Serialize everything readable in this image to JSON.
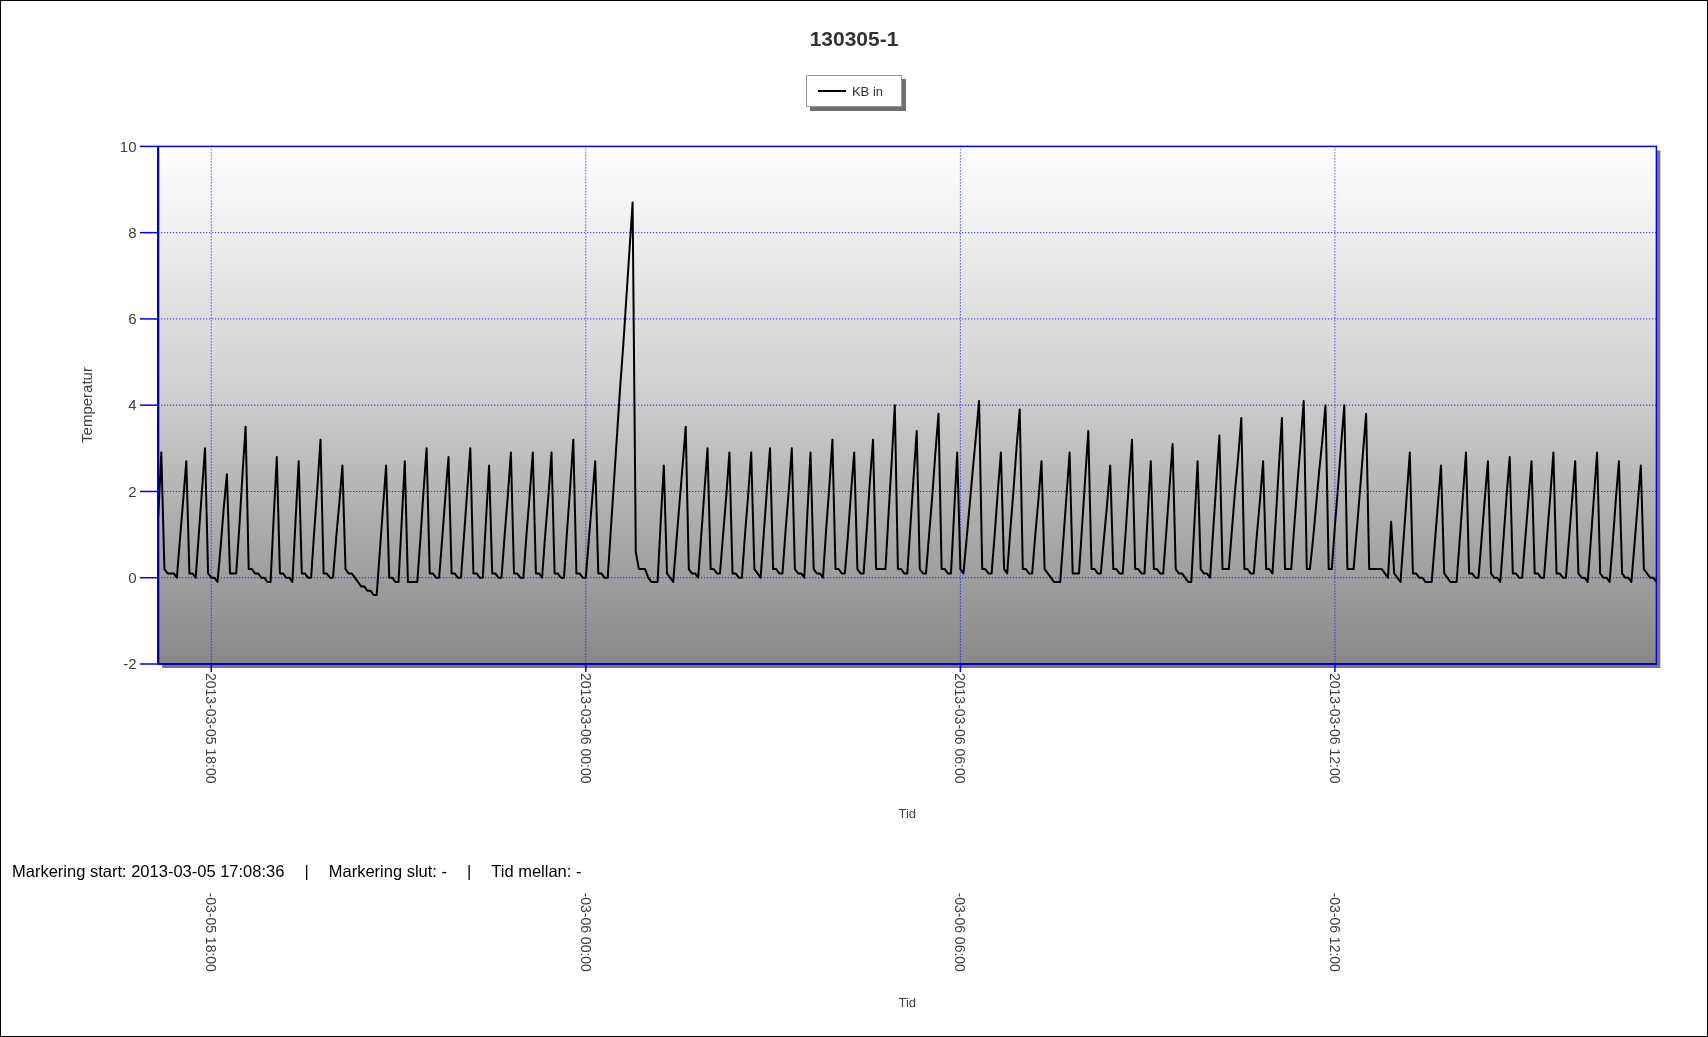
{
  "chart": {
    "chart_data": {
      "type": "line",
      "title": "130305-1",
      "xlabel": "Tid",
      "ylabel": "Temperatur",
      "grid": true,
      "categories": [
        null,
        null,
        null,
        null,
        null,
        null,
        null,
        null,
        null,
        null,
        null,
        null,
        null,
        null,
        null,
        null,
        null,
        "2013-03-05 18:00",
        null,
        null,
        null,
        null,
        null,
        null,
        null,
        null,
        null,
        null,
        null,
        null,
        null,
        null,
        null,
        null,
        null,
        null,
        null,
        null,
        null,
        null,
        null,
        null,
        null,
        null,
        null,
        null,
        null,
        null,
        null,
        null,
        null,
        null,
        null,
        null,
        null,
        null,
        null,
        null,
        null,
        null,
        null,
        null,
        null,
        null,
        null,
        null,
        null,
        null,
        null,
        null,
        null,
        null,
        null,
        null,
        null,
        null,
        null,
        null,
        null,
        null,
        null,
        null,
        null,
        null,
        null,
        null,
        null,
        null,
        null,
        null,
        null,
        null,
        null,
        null,
        null,
        null,
        null,
        null,
        null,
        null,
        null,
        null,
        null,
        null,
        null,
        null,
        null,
        null,
        null,
        null,
        null,
        null,
        null,
        null,
        null,
        null,
        null,
        null,
        null,
        null,
        null,
        null,
        null,
        null,
        null,
        null,
        null,
        null,
        null,
        null,
        null,
        null,
        null,
        null,
        null,
        null,
        null,
        "2013-03-06 00:00",
        null,
        null,
        null,
        null,
        null,
        null,
        null,
        null,
        null,
        null,
        null,
        null,
        null,
        null,
        null,
        null,
        null,
        null,
        null,
        null,
        null,
        null,
        null,
        null,
        null,
        null,
        null,
        null,
        null,
        null,
        null,
        null,
        null,
        null,
        null,
        null,
        null,
        null,
        null,
        null,
        null,
        null,
        null,
        null,
        null,
        null,
        null,
        null,
        null,
        null,
        null,
        null,
        null,
        null,
        null,
        null,
        null,
        null,
        null,
        null,
        null,
        null,
        null,
        null,
        null,
        null,
        null,
        null,
        null,
        null,
        null,
        null,
        null,
        null,
        null,
        null,
        null,
        null,
        null,
        null,
        null,
        null,
        null,
        null,
        null,
        null,
        null,
        null,
        null,
        null,
        null,
        null,
        null,
        null,
        null,
        null,
        null,
        null,
        null,
        null,
        null,
        null,
        null,
        null,
        null,
        null,
        null,
        null,
        null,
        null,
        null,
        null,
        null,
        null,
        null,
        null,
        null,
        null,
        null,
        "2013-03-06 06:00",
        null,
        null,
        null,
        null,
        null,
        null,
        null,
        null,
        null,
        null,
        null,
        null,
        null,
        null,
        null,
        null,
        null,
        null,
        null,
        null,
        null,
        null,
        null,
        null,
        null,
        null,
        null,
        null,
        null,
        null,
        null,
        null,
        null,
        null,
        null,
        null,
        null,
        null,
        null,
        null,
        null,
        null,
        null,
        null,
        null,
        null,
        null,
        null,
        null,
        null,
        null,
        null,
        null,
        null,
        null,
        null,
        null,
        null,
        null,
        null,
        null,
        null,
        null,
        null,
        null,
        null,
        null,
        null,
        null,
        null,
        null,
        null,
        null,
        null,
        null,
        null,
        null,
        null,
        null,
        null,
        null,
        null,
        null,
        null,
        null,
        null,
        null,
        null,
        null,
        null,
        null,
        null,
        null,
        null,
        null,
        null,
        null,
        null,
        null,
        null,
        null,
        null,
        null,
        null,
        null,
        null,
        null,
        null,
        null,
        null,
        null,
        null,
        null,
        null,
        null,
        null,
        null,
        null,
        null,
        "2013-03-06 12:00",
        null,
        null,
        null,
        null,
        null,
        null,
        null,
        null,
        null,
        null,
        null,
        null,
        null,
        null,
        null,
        null,
        null,
        null,
        null,
        null,
        null,
        null,
        null,
        null,
        null,
        null,
        null,
        null,
        null,
        null,
        null,
        null,
        null,
        null,
        null,
        null,
        null,
        null,
        null,
        null,
        null,
        null,
        null,
        null,
        null,
        null,
        null,
        null,
        null,
        null,
        null,
        null,
        null,
        null,
        null,
        null,
        null,
        null,
        null,
        null,
        null,
        null,
        null,
        null,
        null,
        null,
        null,
        null,
        null,
        null,
        null,
        null,
        null,
        null,
        null,
        null,
        null,
        null,
        null,
        null,
        null,
        null,
        null,
        null,
        null,
        null,
        null,
        null,
        null,
        null,
        null,
        null,
        null,
        null,
        null,
        null,
        null,
        null,
        null,
        null,
        null,
        null,
        null
      ],
      "series": [
        {
          "name": "KB in",
          "color": "#000000",
          "values": [
            1.4,
            2.9,
            0.2,
            0.1,
            0.1,
            0.1,
            0,
            0.9,
            1.8,
            2.7,
            0.1,
            0.1,
            0,
            1.0,
            2.0,
            3.0,
            0.1,
            0,
            0,
            -0.1,
            0.7,
            1.6,
            2.4,
            0.1,
            0.1,
            0.1,
            1.2,
            2.4,
            3.5,
            0.2,
            0.2,
            0.1,
            0.1,
            0,
            0,
            -0.1,
            -0.1,
            1.4,
            2.8,
            0.1,
            0.1,
            0,
            0,
            -0.1,
            1.3,
            2.7,
            0.1,
            0.1,
            0,
            0,
            1.1,
            2.1,
            3.2,
            0.1,
            0.1,
            0,
            0,
            0.9,
            1.7,
            2.6,
            0.2,
            0.1,
            0.1,
            0,
            -0.1,
            -0.2,
            -0.2,
            -0.3,
            -0.3,
            -0.4,
            -0.4,
            0.6,
            1.6,
            2.6,
            0,
            0,
            -0.1,
            -0.1,
            1.3,
            2.7,
            -0.1,
            -0.1,
            -0.1,
            -0.1,
            0.9,
            2.0,
            3.0,
            0.1,
            0.1,
            0,
            0,
            0.9,
            1.9,
            2.8,
            0.1,
            0.1,
            0,
            0,
            1.0,
            2.0,
            3.0,
            0.1,
            0.1,
            0,
            0,
            1.3,
            2.6,
            0.1,
            0.1,
            0,
            0,
            1.0,
            1.9,
            2.9,
            0.1,
            0.1,
            0,
            0,
            1.0,
            1.9,
            2.9,
            0.1,
            0.1,
            0,
            1.0,
            1.9,
            2.9,
            0.1,
            0.1,
            0,
            0,
            1.1,
            2.1,
            3.2,
            0.1,
            0.1,
            0,
            0,
            0.9,
            1.8,
            2.7,
            0.1,
            0.1,
            0,
            0,
            1.1,
            2.2,
            3.3,
            4.4,
            5.4,
            6.5,
            7.6,
            8.7,
            0.6,
            0.2,
            0.2,
            0.2,
            0,
            -0.1,
            -0.1,
            -0.1,
            1.3,
            2.6,
            0.1,
            0,
            -0.1,
            0.8,
            1.7,
            2.6,
            3.5,
            0.2,
            0.1,
            0.1,
            0,
            1.0,
            2.0,
            3.0,
            0.2,
            0.2,
            0.1,
            0.1,
            1.0,
            1.9,
            2.9,
            0.1,
            0.1,
            0,
            0,
            1.0,
            1.9,
            2.9,
            0.2,
            0.1,
            0,
            1.0,
            2.0,
            3.0,
            0.2,
            0.2,
            0.1,
            0.1,
            1.1,
            2.0,
            3.0,
            0.2,
            0.1,
            0.1,
            0,
            1.5,
            2.9,
            0.2,
            0.1,
            0.1,
            0,
            1.1,
            2.1,
            3.2,
            0.2,
            0.2,
            0.1,
            0.1,
            1.0,
            2.0,
            2.9,
            0.2,
            0.1,
            0.1,
            1.1,
            2.2,
            3.2,
            0.2,
            0.2,
            0.2,
            0.2,
            1.5,
            2.7,
            4.0,
            0.2,
            0.2,
            0.1,
            0.1,
            1.2,
            2.3,
            3.4,
            0.2,
            0.1,
            0.1,
            1.0,
            1.9,
            2.9,
            3.8,
            0.2,
            0.2,
            0.1,
            0.1,
            1.5,
            2.9,
            0.2,
            0.1,
            0.9,
            1.7,
            2.5,
            3.3,
            4.1,
            0.2,
            0.2,
            0.1,
            0.1,
            1.0,
            2.0,
            2.9,
            0.2,
            0.1,
            1.1,
            2.0,
            3.0,
            3.9,
            0.2,
            0.2,
            0.1,
            0.1,
            1.0,
            1.8,
            2.7,
            0.2,
            0.1,
            0,
            -0.1,
            -0.1,
            -0.1,
            0.9,
            1.9,
            2.9,
            0.1,
            0.1,
            0.1,
            1.2,
            2.3,
            3.4,
            0.2,
            0.2,
            0.1,
            0.1,
            0.9,
            1.7,
            2.6,
            0.2,
            0.2,
            0.1,
            0.1,
            1.1,
            2.2,
            3.2,
            0.2,
            0.2,
            0.1,
            0.1,
            1.4,
            2.7,
            0.2,
            0.2,
            0.1,
            0.1,
            1.1,
            2.1,
            3.1,
            0.2,
            0.1,
            0.1,
            0,
            -0.1,
            -0.1,
            1.3,
            2.7,
            0.2,
            0.1,
            0.1,
            0,
            1.1,
            2.2,
            3.3,
            0.2,
            0.2,
            0.2,
            1.1,
            2.0,
            2.8,
            3.7,
            0.2,
            0.2,
            0.1,
            0.1,
            1.0,
            1.8,
            2.7,
            0.2,
            0.2,
            0.1,
            1.3,
            2.5,
            3.7,
            0.2,
            0.2,
            0.2,
            1.2,
            2.2,
            3.1,
            4.1,
            0.2,
            0.2,
            0.9,
            1.7,
            2.5,
            3.2,
            4.0,
            0.2,
            0.2,
            1.2,
            2.1,
            3.1,
            4.0,
            0.2,
            0.2,
            0.2,
            1.1,
            2.0,
            2.9,
            3.8,
            0.2,
            0.2,
            0.2,
            0.2,
            0.2,
            0.1,
            0,
            1.3,
            0.1,
            0,
            -0.1,
            0.9,
            1.9,
            2.9,
            0.1,
            0.1,
            0,
            0,
            -0.1,
            -0.1,
            -0.1,
            0.8,
            1.7,
            2.6,
            0.1,
            0,
            -0.1,
            -0.1,
            -0.1,
            0.9,
            1.9,
            2.9,
            0.1,
            0.1,
            0,
            0,
            0.9,
            1.8,
            2.7,
            0.1,
            0,
            0,
            -0.1,
            0.9,
            1.9,
            2.8,
            0.1,
            0.1,
            0,
            0,
            0.9,
            1.8,
            2.7,
            0.1,
            0.1,
            0,
            0,
            1.0,
            1.9,
            2.9,
            0.1,
            0.1,
            0,
            0,
            0.9,
            1.8,
            2.7,
            0.1,
            0,
            0,
            -0.1,
            0.9,
            1.9,
            2.9,
            0.1,
            0,
            0,
            -0.1,
            0.8,
            1.8,
            2.7,
            0.1,
            0,
            0,
            -0.1,
            0.8,
            1.7,
            2.6,
            0.2,
            0.1,
            0,
            0,
            -0.1
          ]
        }
      ],
      "ylim": [
        -2,
        10
      ],
      "yticks": [
        -2,
        0,
        2,
        4,
        6,
        8,
        10
      ]
    }
  },
  "status_bar": {
    "items": [
      "Markering start: 2013-03-05 17:08:36",
      "Markering slut: -",
      "Tid mellan: -"
    ],
    "separators": [
      "|",
      "|"
    ]
  },
  "axis_repeat": {
    "tick_labels": [
      "-03-05 18:00",
      "-03-06 00:00",
      "-03-06 06:00",
      "-03-06 12:00"
    ],
    "title": "Tid"
  }
}
